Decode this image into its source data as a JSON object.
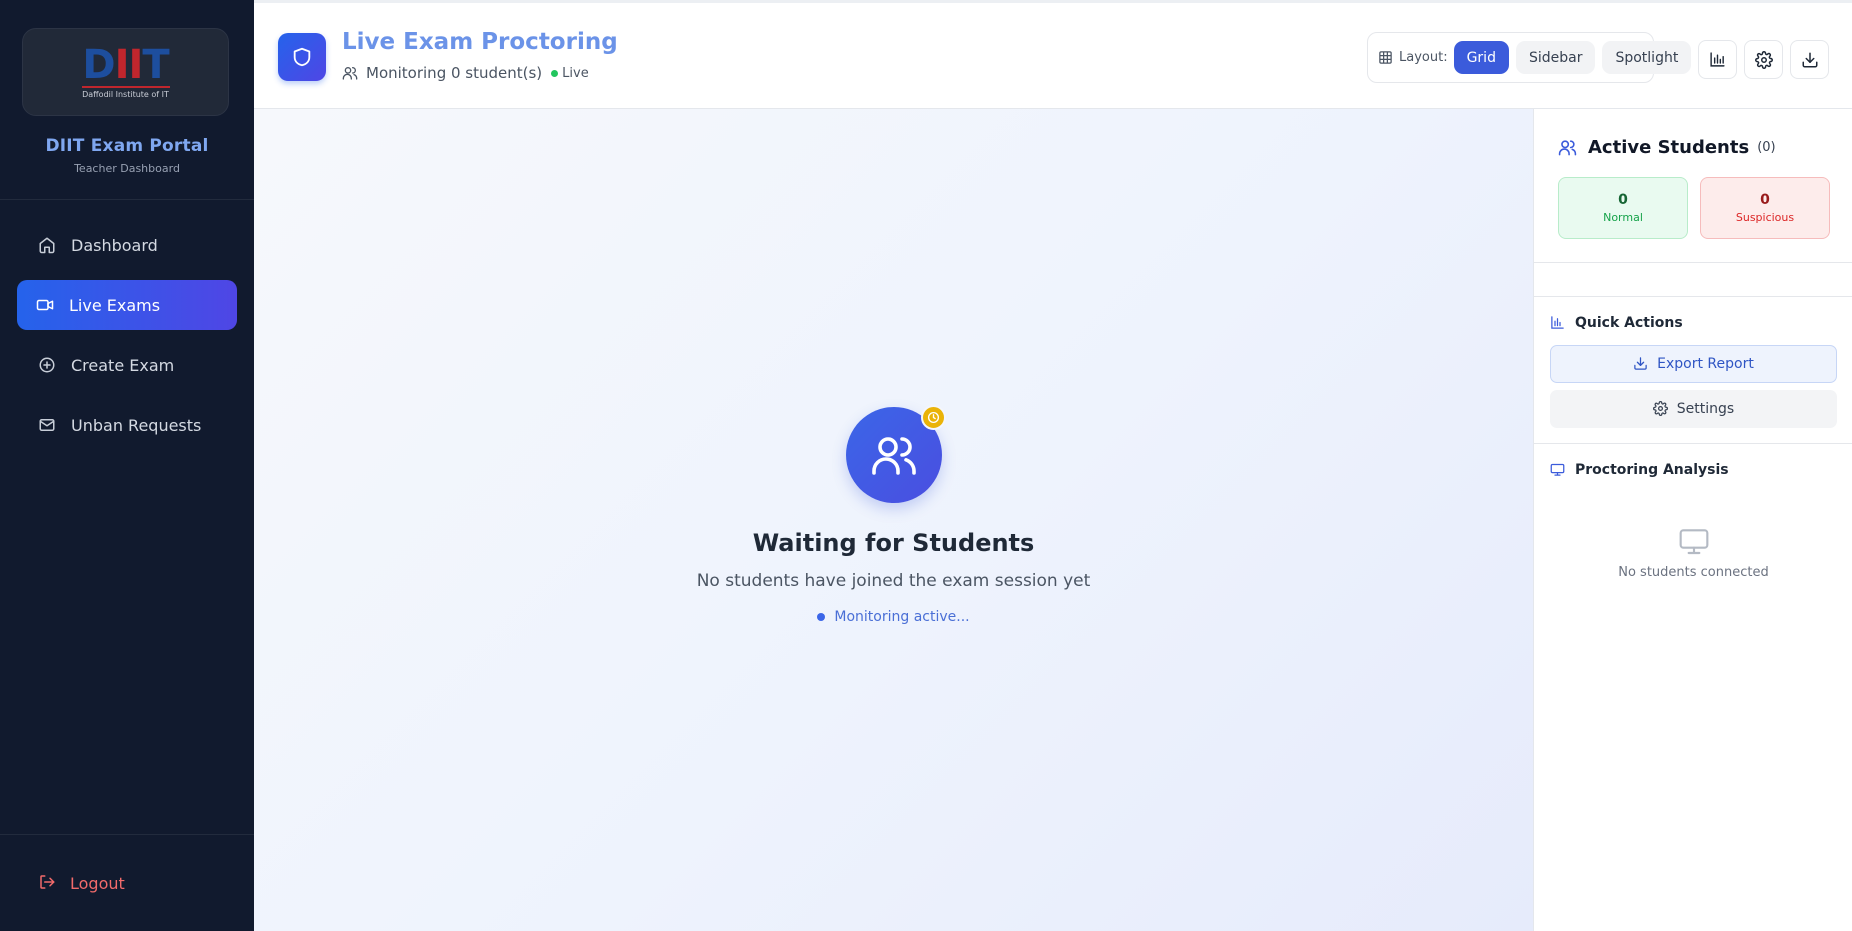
{
  "sidebar": {
    "logo": {
      "letters_d": "D",
      "letters_ii": "II",
      "letters_t": "T",
      "subtitle": "Daffodil Institute of IT"
    },
    "portal_title": "DIIT Exam Portal",
    "portal_subtitle": "Teacher Dashboard",
    "nav": [
      {
        "label": "Dashboard",
        "icon": "home-icon",
        "active": false
      },
      {
        "label": "Live Exams",
        "icon": "video-camera-icon",
        "active": true
      },
      {
        "label": "Create Exam",
        "icon": "plus-circle-icon",
        "active": false
      },
      {
        "label": "Unban Requests",
        "icon": "mail-icon",
        "active": false
      }
    ],
    "logout_label": "Logout"
  },
  "header": {
    "title": "Live Exam Proctoring",
    "monitoring_text": "Monitoring 0 student(s)",
    "live_label": "Live",
    "layout_label": "Layout:",
    "layout_options": [
      "Grid",
      "Sidebar",
      "Spotlight"
    ],
    "layout_selected": "Grid",
    "icons": [
      "bar-chart-icon",
      "gear-icon",
      "download-icon"
    ]
  },
  "main": {
    "empty_title": "Waiting for Students",
    "empty_subtitle": "No students have joined the exam session yet",
    "status_text": "Monitoring active..."
  },
  "right_panel": {
    "title": "Active Students",
    "count": "(0)",
    "stats": {
      "normal_value": "0",
      "normal_label": "Normal",
      "suspicious_value": "0",
      "suspicious_label": "Suspicious"
    },
    "quick_actions_title": "Quick Actions",
    "export_label": "Export Report",
    "settings_label": "Settings",
    "analysis_title": "Proctoring Analysis",
    "no_students_text": "No students connected"
  },
  "colors": {
    "sidebar_bg": "#111a2e",
    "accent": "#2563eb",
    "accent_secondary": "#4f46e5",
    "live_green": "#22c55e",
    "logout_red": "#f26b6b",
    "badge_yellow": "#eab308"
  }
}
